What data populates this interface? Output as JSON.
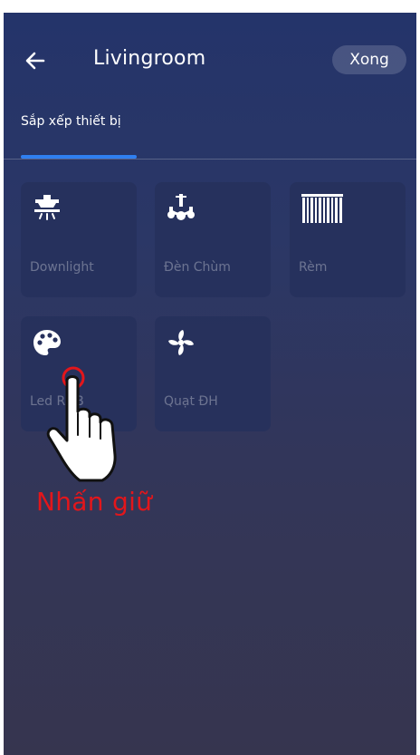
{
  "header": {
    "title": "Livingroom",
    "done_label": "Xong"
  },
  "tabs": [
    {
      "label": "Sắp xếp thiết bị",
      "active": true
    }
  ],
  "devices": [
    {
      "label": "Downlight",
      "icon": "downlight-icon"
    },
    {
      "label": "Đèn Chùm",
      "icon": "chandelier-icon"
    },
    {
      "label": "Rèm",
      "icon": "curtain-icon"
    },
    {
      "label": "Led RGB",
      "icon": "palette-icon"
    },
    {
      "label": "Quạt ĐH",
      "icon": "fan-icon"
    }
  ],
  "hint": {
    "text": "Nhấn giữ"
  },
  "colors": {
    "accent": "#2f7ff0",
    "hint": "#e3161b",
    "tile_bg": "#26305c"
  }
}
